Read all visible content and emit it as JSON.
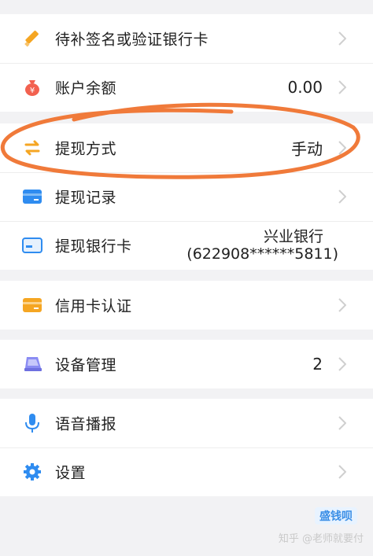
{
  "groups": [
    {
      "items": [
        {
          "label": "待补签名或验证银行卡",
          "icon": "pencil-icon",
          "value": ""
        },
        {
          "label": "账户余额",
          "icon": "money-bag-icon",
          "value": "0.00"
        }
      ]
    },
    {
      "items": [
        {
          "label": "提现方式",
          "icon": "swap-icon",
          "value": "手动"
        },
        {
          "label": "提现记录",
          "icon": "card-record-icon",
          "value": ""
        },
        {
          "label": "提现银行卡",
          "icon": "bank-card-icon",
          "value_line1": "兴业银行",
          "value_line2": "(622908******5811)"
        }
      ]
    },
    {
      "items": [
        {
          "label": "信用卡认证",
          "icon": "credit-card-icon",
          "value": ""
        }
      ]
    },
    {
      "items": [
        {
          "label": "设备管理",
          "icon": "device-icon",
          "value": "2"
        }
      ]
    },
    {
      "items": [
        {
          "label": "语音播报",
          "icon": "microphone-icon",
          "value": ""
        },
        {
          "label": "设置",
          "icon": "gear-icon",
          "value": ""
        }
      ]
    }
  ],
  "watermark": {
    "brand": "盛钱呗",
    "text": "知乎 @老师就要付"
  },
  "colors": {
    "highlight": "#f07a3a",
    "chevron": "#cfcfcf",
    "orange": "#f5a623",
    "blue": "#2f8cf0",
    "red": "#f2614f"
  }
}
